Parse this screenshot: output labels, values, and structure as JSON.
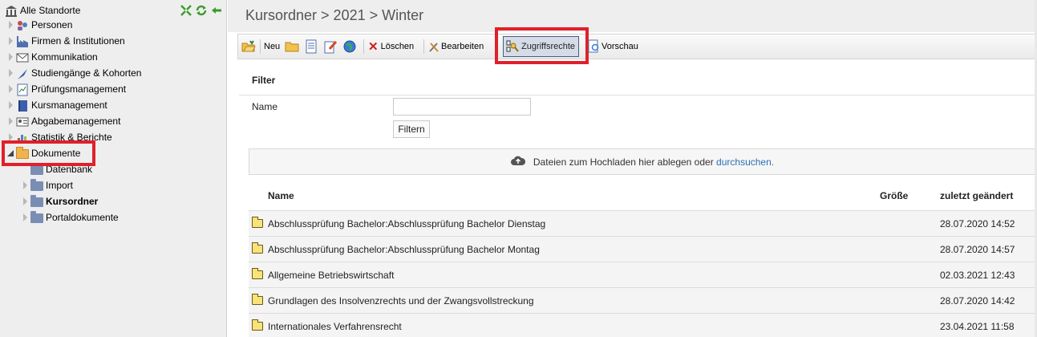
{
  "sidebar": {
    "root": "Alle Standorte",
    "items": [
      {
        "label": "Personen"
      },
      {
        "label": "Firmen & Institutionen"
      },
      {
        "label": "Kommunikation"
      },
      {
        "label": "Studiengänge & Kohorten"
      },
      {
        "label": "Prüfungsmanagement"
      },
      {
        "label": "Kursmanagement"
      },
      {
        "label": "Abgabemanagement"
      },
      {
        "label": "Statistik & Berichte"
      },
      {
        "label": "Dokumente"
      }
    ],
    "subitems": [
      {
        "label": "Datenbank"
      },
      {
        "label": "Import"
      },
      {
        "label": "Kursordner"
      },
      {
        "label": "Portaldokumente"
      }
    ]
  },
  "main": {
    "title": "Kursordner > 2021 > Winter",
    "toolbar": {
      "new": "Neu",
      "delete": "Löschen",
      "edit": "Bearbeiten",
      "access": "Zugriffsrechte",
      "preview": "Vorschau"
    },
    "filter": {
      "title": "Filter",
      "name_label": "Name",
      "name_value": "",
      "button": "Filtern"
    },
    "dropzone": {
      "text": "Dateien zum Hochladen hier ablegen oder",
      "link": "durchsuchen."
    },
    "table": {
      "headers": {
        "name": "Name",
        "size": "Größe",
        "modified": "zuletzt geändert"
      },
      "rows": [
        {
          "name": "Abschlussprüfung Bachelor:Abschlussprüfung Bachelor Dienstag",
          "size": "",
          "modified": "28.07.2020 14:52"
        },
        {
          "name": "Abschlussprüfung Bachelor:Abschlussprüfung Bachelor Montag",
          "size": "",
          "modified": "28.07.2020 14:57"
        },
        {
          "name": "Allgemeine Betriebswirtschaft",
          "size": "",
          "modified": "02.03.2021 12:43"
        },
        {
          "name": "Grundlagen des Insolvenzrechts und der Zwangsvollstreckung",
          "size": "",
          "modified": "28.07.2020 14:42"
        },
        {
          "name": "Internationales Verfahrensrecht",
          "size": "",
          "modified": "23.04.2021 11:58"
        }
      ]
    }
  },
  "colors": {
    "highlight": "#e0202a",
    "link": "#2a6fb6",
    "active_button": "#d6dce7"
  }
}
